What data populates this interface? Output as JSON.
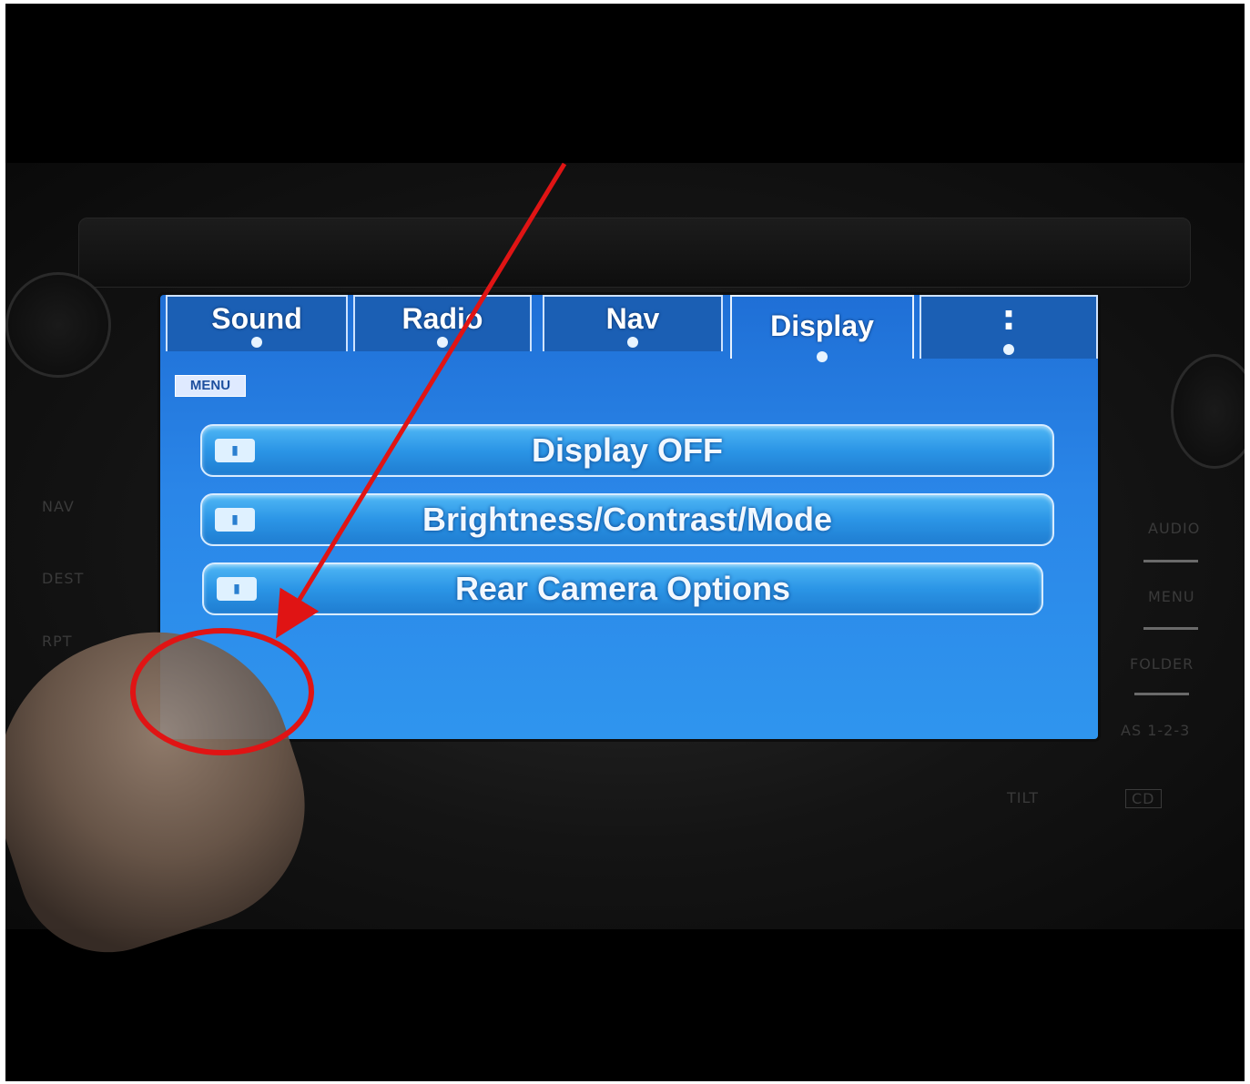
{
  "screen": {
    "tabs": [
      {
        "label": "Sound",
        "active": false
      },
      {
        "label": "Radio",
        "active": false
      },
      {
        "label": "Nav",
        "active": false
      },
      {
        "label": "Display",
        "active": true
      },
      {
        "label": ":",
        "active": false
      }
    ],
    "menu_badge": "MENU",
    "buttons": [
      {
        "label": "Display OFF"
      },
      {
        "label": "Brightness/Contrast/Mode"
      },
      {
        "label": "Rear Camera Options"
      }
    ]
  },
  "hardware_labels": {
    "left": [
      "NAV",
      "DEST",
      "RPT"
    ],
    "right": [
      "AUDIO",
      "MENU",
      "FOLDER",
      "AS 1-2-3"
    ],
    "bottom": [
      "TILT",
      "CD"
    ]
  },
  "colors": {
    "screen_blue": "#2a86e8",
    "annotation_red": "#e01414"
  }
}
